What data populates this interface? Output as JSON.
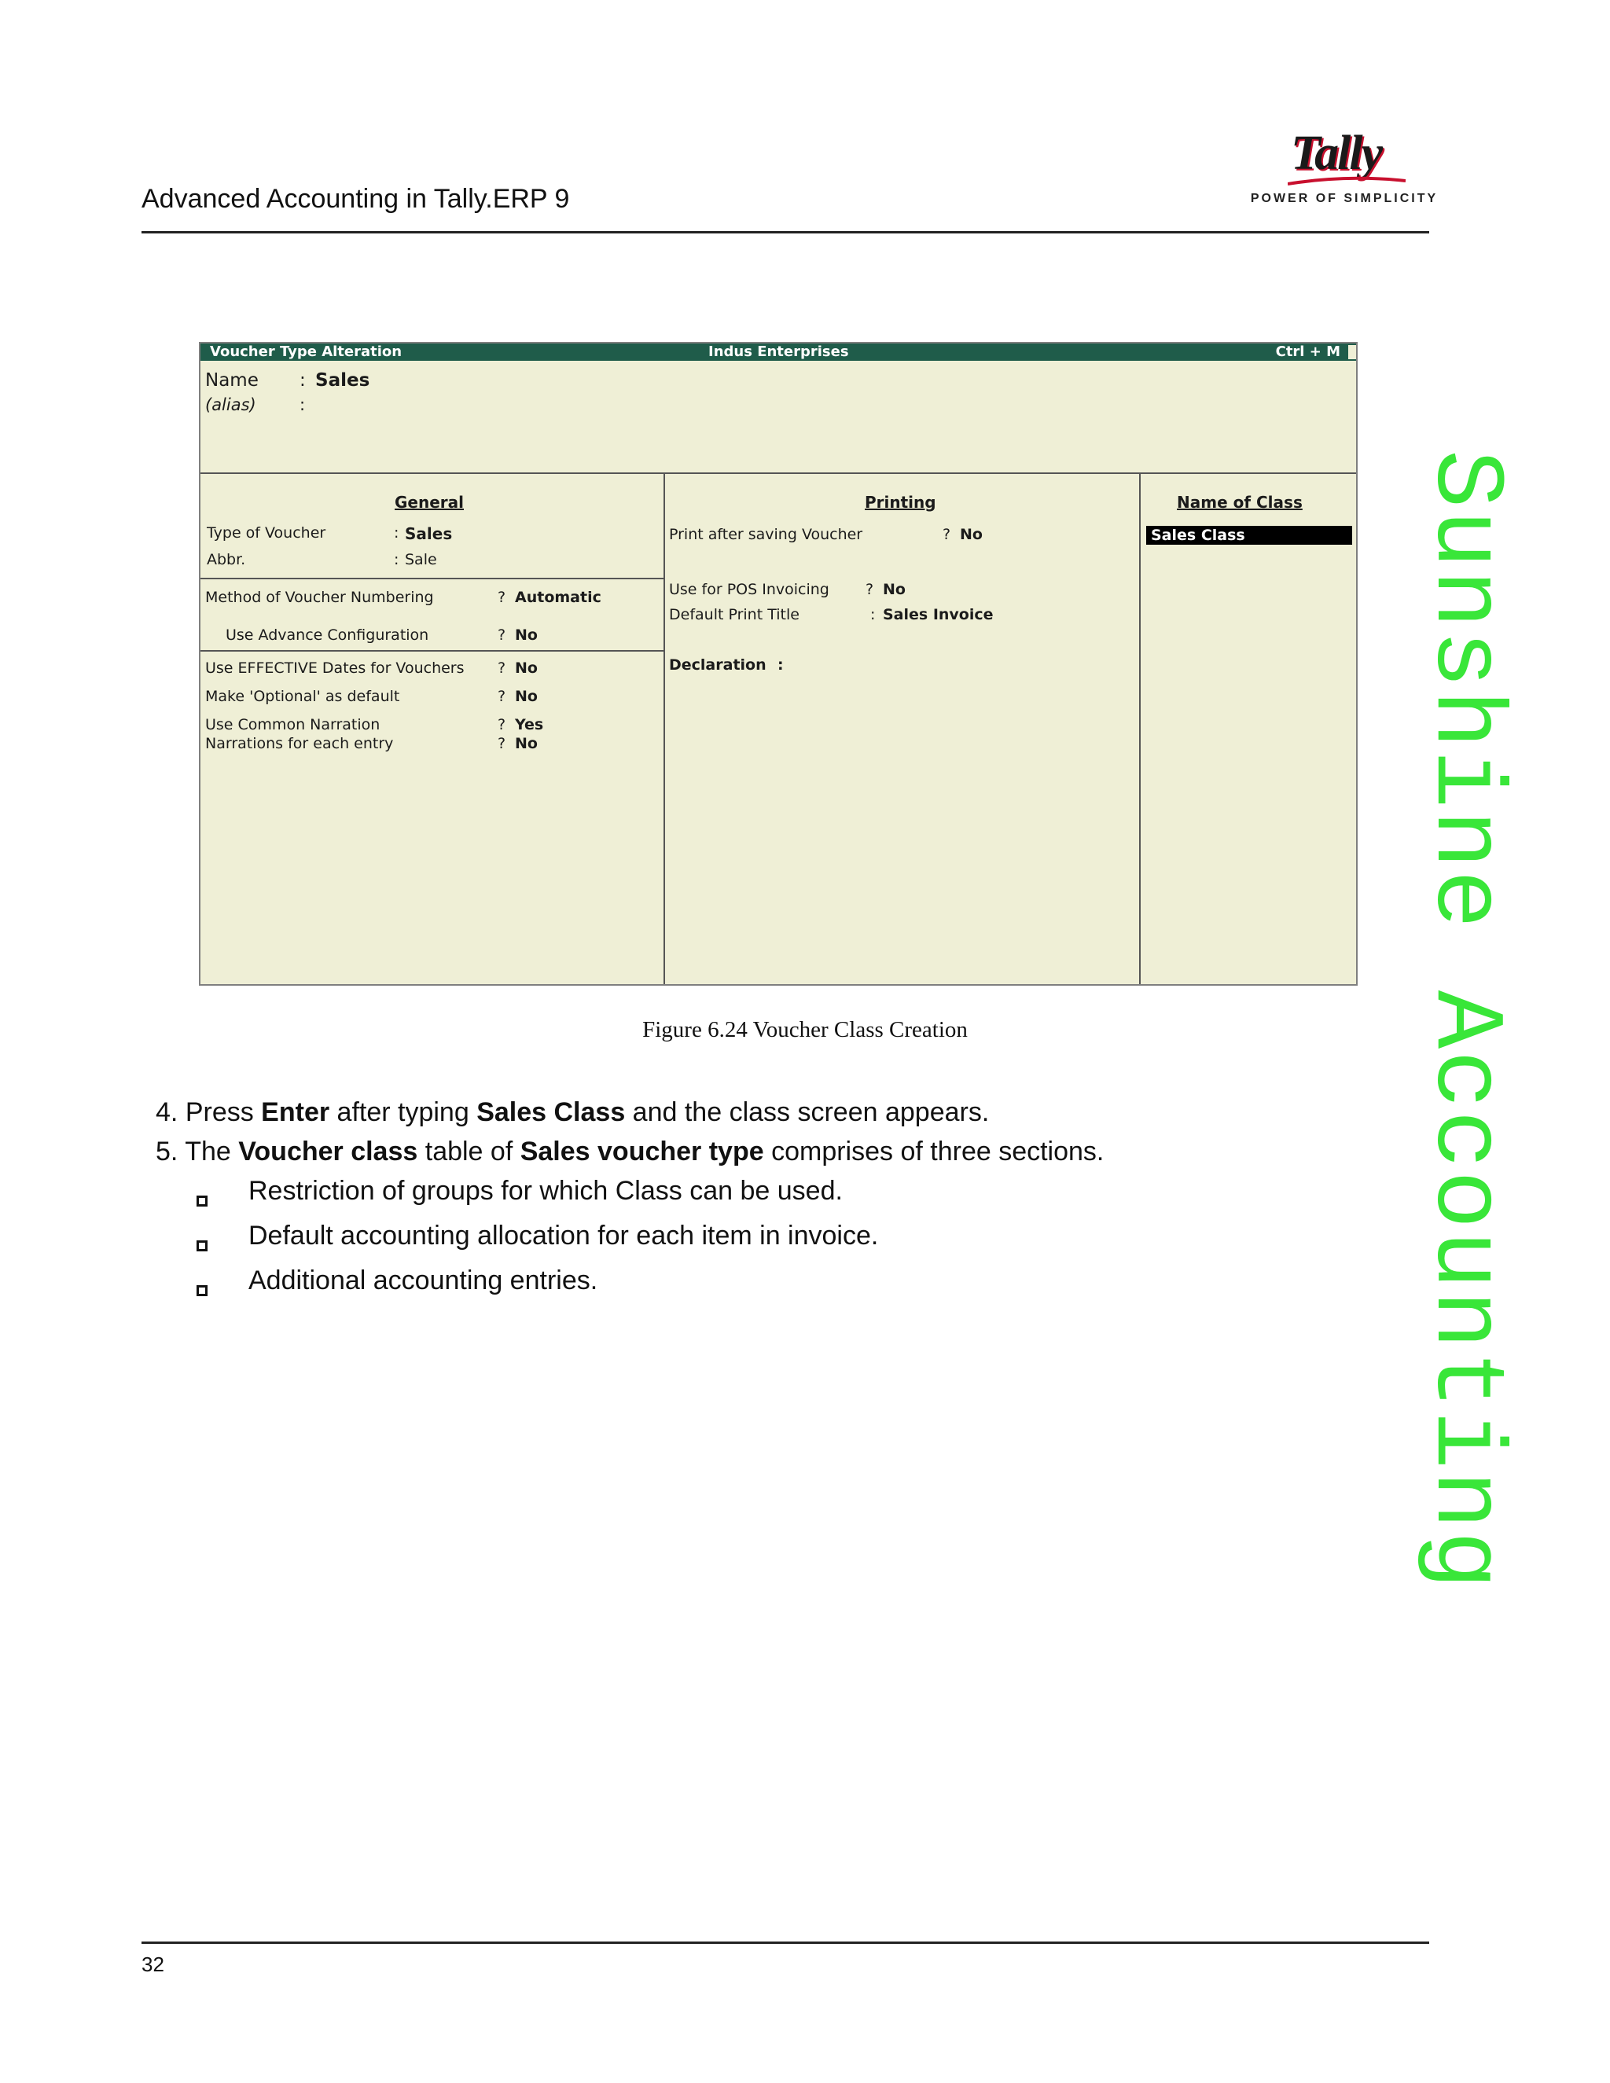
{
  "header": {
    "title": "Advanced Accounting in Tally.ERP 9",
    "logo_text": "Tally",
    "logo_tagline": "POWER OF SIMPLICITY",
    "logo_accent_color": "#c8102e"
  },
  "watermark": "Sunshine Accounting",
  "screen": {
    "titlebar": {
      "left": "Voucher Type Alteration",
      "center": "Indus Enterprises",
      "right": "Ctrl + M"
    },
    "name_label": "Name",
    "name_colon": ":",
    "name_value": "Sales",
    "alias_label": "(alias)",
    "alias_colon": ":",
    "general": {
      "heading": "General",
      "type_of_voucher": {
        "label": "Type of Voucher",
        "sep": ":",
        "value": "Sales"
      },
      "abbr": {
        "label": "Abbr.",
        "sep": ":",
        "value": "Sale"
      },
      "numbering": {
        "label": "Method of Voucher Numbering",
        "sep": "?",
        "value": "Automatic"
      },
      "advance_config": {
        "label": "Use Advance Configuration",
        "sep": "?",
        "value": "No"
      },
      "effective_dates": {
        "label": "Use EFFECTIVE Dates for Vouchers",
        "sep": "?",
        "value": "No"
      },
      "optional_default": {
        "label": "Make 'Optional' as default",
        "sep": "?",
        "value": "No"
      },
      "common_narration": {
        "label": "Use Common Narration",
        "sep": "?",
        "value": "Yes"
      },
      "narrations_each": {
        "label": "Narrations for each entry",
        "sep": "?",
        "value": "No"
      }
    },
    "printing": {
      "heading": "Printing",
      "print_after_saving": {
        "label": "Print after saving Voucher",
        "sep": "?",
        "value": "No"
      },
      "pos_invoicing": {
        "label": "Use for POS Invoicing",
        "sep": "?",
        "value": "No"
      },
      "default_print_title": {
        "label": "Default Print Title",
        "sep": ":",
        "value": "Sales Invoice"
      },
      "declaration": "Declaration",
      "declaration_colon": ":"
    },
    "class": {
      "heading": "Name of Class",
      "selected": "Sales Class"
    }
  },
  "figure_caption": "Figure 6.24  Voucher Class Creation",
  "steps": [
    {
      "num": "4.",
      "t1": "Press ",
      "b1": "Enter",
      "t2": " after typing ",
      "b2": "Sales Class",
      "t3": " and the class screen appears."
    },
    {
      "num": "5.",
      "t1": "The ",
      "b1": "Voucher class",
      "t2": " table of ",
      "b2": "Sales voucher type",
      "t3": " comprises of three sections."
    }
  ],
  "bullets": [
    "Restriction of groups for which Class can be used.",
    "Default accounting allocation for each item in invoice.",
    "Additional accounting entries."
  ],
  "page_number": "32"
}
